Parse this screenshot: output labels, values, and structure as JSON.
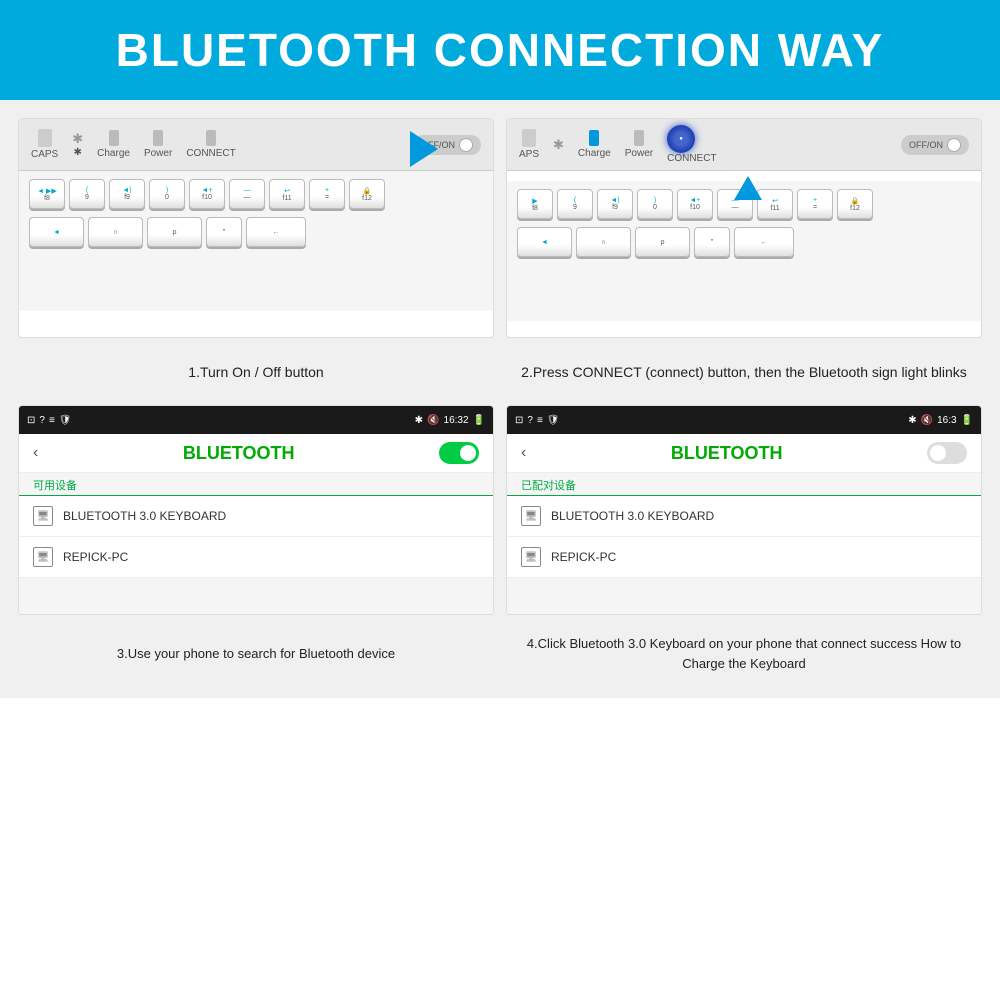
{
  "header": {
    "title": "BLUETOOTH CONNECTION WAY",
    "bg_color": "#00aadd"
  },
  "steps": [
    {
      "id": 1,
      "label": "1.Turn On / Off button"
    },
    {
      "id": 2,
      "label": "2.Press CONNECT (connect) button, then the Bluetooth sign light blinks"
    },
    {
      "id": 3,
      "label": "3.Use your phone to search for Bluetooth device"
    },
    {
      "id": 4,
      "label": "4.Click Bluetooth 3.0 Keyboard on your phone that connect success How to Charge the Keyboard"
    }
  ],
  "keyboard": {
    "labels": [
      "CAPS",
      "Charge",
      "Power",
      "CONNECT",
      "OFF/ON"
    ],
    "keys": [
      {
        "top": "◄ ▶▶",
        "bot": "f8"
      },
      {
        "top": "(",
        "bot": "9"
      },
      {
        "top": "◄)",
        "bot": "f9"
      },
      {
        "top": "◄)",
        "bot": "0"
      },
      {
        "top": "◄+",
        "bot": "f10"
      },
      {
        "top": "—",
        "bot": "—"
      },
      {
        "top": "↩",
        "bot": "f11"
      },
      {
        "top": "+",
        "bot": "="
      },
      {
        "top": "🔒",
        "bot": "f12"
      }
    ]
  },
  "phone_screens": [
    {
      "status_time": "16:32",
      "bluetooth_title": "BLUETOOTH",
      "section_label": "可用设备",
      "devices": [
        "BLUETOOTH 3.0 KEYBOARD",
        "REPICK-PC"
      ],
      "toggle_on": true
    },
    {
      "status_time": "16:3",
      "bluetooth_title": "BLUETOOTH",
      "section_label": "已配对设备",
      "devices": [
        "BLUETOOTH 3.0 KEYBOARD",
        "REPICK-PC"
      ],
      "toggle_on": false
    }
  ]
}
